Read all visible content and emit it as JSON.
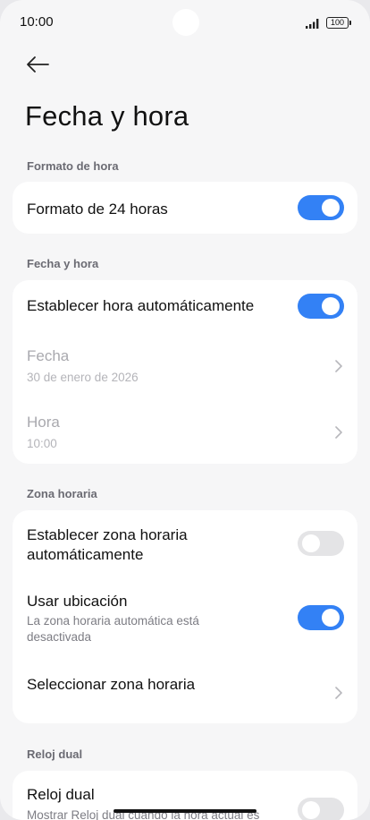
{
  "status_bar": {
    "time": "10:00",
    "battery": "100",
    "icons": [
      "signal-icon",
      "battery-icon"
    ]
  },
  "header": {
    "back_icon": "arrow-left-icon",
    "title": "Fecha y hora"
  },
  "sections": {
    "format": {
      "header": "Formato de hora",
      "format_24h": {
        "label": "Formato de 24 horas",
        "enabled": true
      }
    },
    "date_time": {
      "header": "Fecha y hora",
      "auto_time": {
        "label": "Establecer hora automáticamente",
        "enabled": true
      },
      "date": {
        "label": "Fecha",
        "value": "30 de enero de 2026"
      },
      "time": {
        "label": "Hora",
        "value": "10:00"
      }
    },
    "timezone": {
      "header": "Zona horaria",
      "auto_zone": {
        "label_line1": "Establecer zona horaria",
        "label_line2": "automáticamente",
        "enabled": false
      },
      "use_location": {
        "label": "Usar ubicación",
        "sub_line1": "La zona horaria automática está",
        "sub_line2": "desactivada",
        "enabled": true
      },
      "select_zone": {
        "label": "Seleccionar zona horaria"
      }
    },
    "dual_clock": {
      "header": "Reloj dual",
      "dual_clock": {
        "label": "Reloj dual",
        "sub": "Mostrar Reloj dual cuando la hora actual es",
        "enabled": false
      }
    }
  },
  "colors": {
    "accent": "#3381f5",
    "toggle_off": "#e4e4e6",
    "background": "#f6f6f7",
    "card": "#ffffff"
  }
}
